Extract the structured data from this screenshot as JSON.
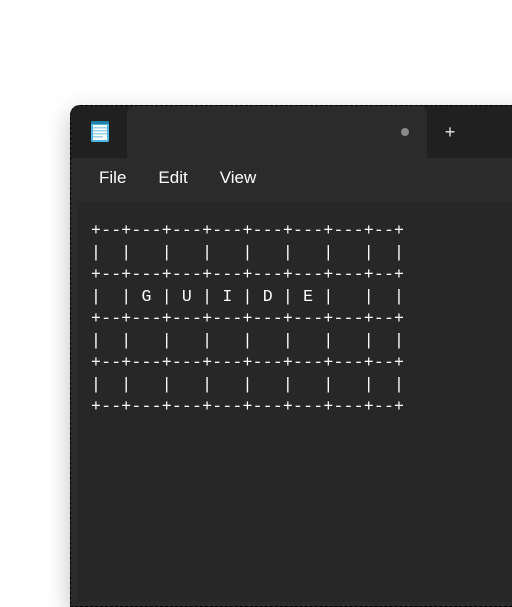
{
  "titlebar": {
    "app_icon_name": "notepad-icon",
    "tab_title": "",
    "dirty": true
  },
  "menubar": {
    "file": "File",
    "edit": "Edit",
    "view": "View"
  },
  "editor": {
    "content": "+--+---+---+---+---+---+---+--+\n|  |   |   |   |   |   |   |  |\n+--+---+---+---+---+---+---+--+\n|  | G | U | I | D | E |   |  |\n+--+---+---+---+---+---+---+--+\n|  |   |   |   |   |   |   |  |\n+--+---+---+---+---+---+---+--+\n|  |   |   |   |   |   |   |  |\n+--+---+---+---+---+---+---+--+"
  },
  "icons": {
    "new_tab": "+"
  }
}
